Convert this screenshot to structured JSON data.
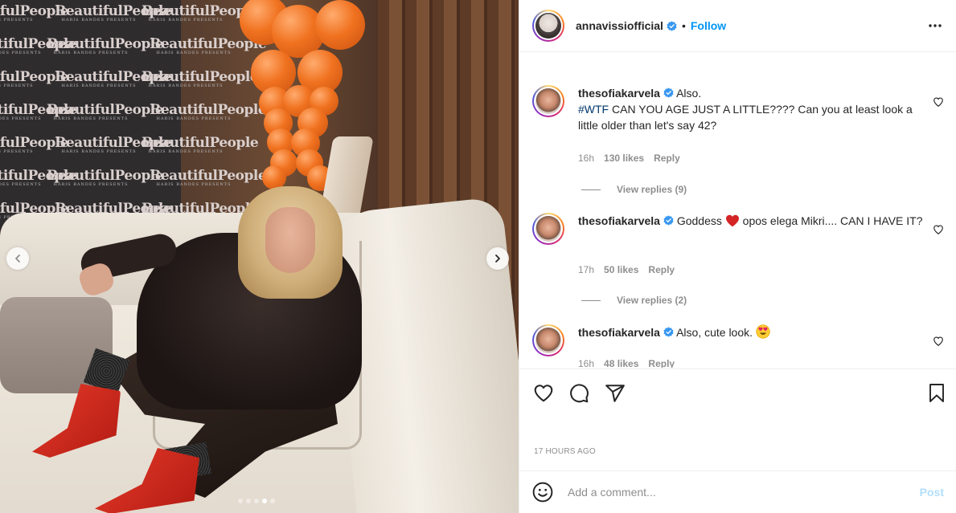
{
  "post": {
    "author": "annavissiofficial",
    "follow_label": "Follow",
    "bullet": "•",
    "carousel": {
      "total_slides": 5,
      "active_slide": 4
    },
    "image_backdrop_brand": "BeautifulPeople",
    "image_backdrop_sub": "HARIS BANDES PRESENTS"
  },
  "comments": [
    {
      "username": "thesofiakarvela",
      "text_pre": "Also.",
      "hashtag": "#WTF",
      "text": " CAN YOU AGE JUST A LITTLE???? Can you at least look a little older than let's say 42?",
      "time": "16h",
      "likes": "130 likes",
      "reply": "Reply",
      "view_replies": "View replies (9)"
    },
    {
      "username": "thesofiakarvela",
      "text_a": "Goddess",
      "text_b": "opos elega Mikri.... CAN I HAVE IT?",
      "time": "17h",
      "likes": "50 likes",
      "reply": "Reply",
      "view_replies": "View replies (2)"
    },
    {
      "username": "thesofiakarvela",
      "text": "Also, cute look.",
      "time": "16h",
      "likes": "48 likes",
      "reply": "Reply"
    }
  ],
  "timestamp": "17 HOURS AGO",
  "add_comment": {
    "placeholder": "Add a comment...",
    "post_label": "Post"
  },
  "icons": {
    "like": "heart-icon",
    "comment": "comment-icon",
    "share": "share-icon",
    "save": "bookmark-icon",
    "more": "more-options-icon",
    "emoji": "emoji-icon"
  },
  "colors": {
    "accent": "#0095f6",
    "text": "#262626",
    "muted": "#8e8e8e",
    "post_disabled": "#b2dffc"
  }
}
